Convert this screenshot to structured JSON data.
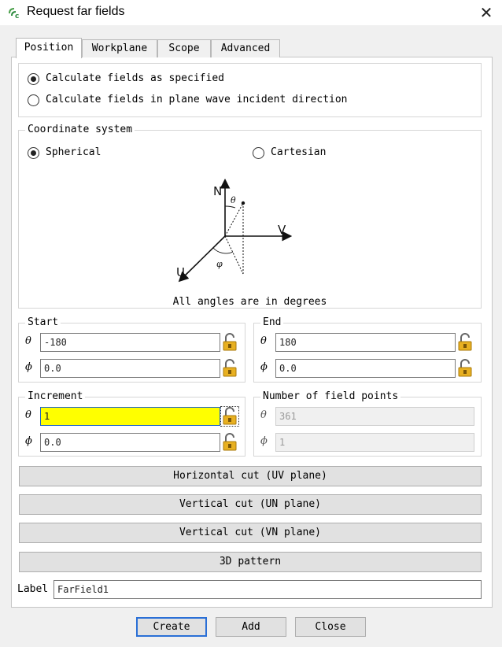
{
  "window": {
    "title": "Request far fields",
    "close_glyph": "✕"
  },
  "tabs": [
    {
      "label": "Position",
      "active": true
    },
    {
      "label": "Workplane",
      "active": false
    },
    {
      "label": "Scope",
      "active": false
    },
    {
      "label": "Advanced",
      "active": false
    }
  ],
  "mode": {
    "options": [
      {
        "label": "Calculate fields as specified",
        "checked": true
      },
      {
        "label": "Calculate fields in plane wave incident direction",
        "checked": false
      }
    ]
  },
  "coordinate_system": {
    "legend": "Coordinate system",
    "options": [
      {
        "label": "Spherical",
        "checked": true
      },
      {
        "label": "Cartesian",
        "checked": false
      }
    ],
    "diagram": {
      "axis_n": "N",
      "axis_v": "V",
      "axis_u": "U",
      "theta_label": "θ",
      "phi_label": "φ",
      "note": "All angles are in degrees"
    }
  },
  "start": {
    "legend": "Start",
    "theta_symbol": "θ",
    "phi_symbol": "ϕ",
    "theta_value": "-180",
    "phi_value": "0.0"
  },
  "end": {
    "legend": "End",
    "theta_symbol": "θ",
    "phi_symbol": "ϕ",
    "theta_value": "180",
    "phi_value": "0.0"
  },
  "increment": {
    "legend": "Increment",
    "theta_symbol": "θ",
    "phi_symbol": "ϕ",
    "theta_value": "1",
    "phi_value": "0.0"
  },
  "field_points": {
    "legend": "Number of field points",
    "theta_symbol": "θ",
    "phi_symbol": "ϕ",
    "theta_value": "361",
    "phi_value": "1"
  },
  "cuts": {
    "horizontal": "Horizontal cut (UV plane)",
    "vertical_un": "Vertical cut (UN plane)",
    "vertical_vn": "Vertical cut (VN plane)",
    "pattern_3d": "3D pattern"
  },
  "label": {
    "caption": "Label",
    "value": "FarField1"
  },
  "footer": {
    "create": "Create",
    "add": "Add",
    "close": "Close"
  },
  "icons": {
    "app": "feko-app-icon",
    "lock": "padlock-open-icon",
    "close": "close-icon"
  },
  "colors": {
    "highlight_input": "#ffff00",
    "focus_border": "#2a6fd6",
    "lock_gold": "#e8b021"
  }
}
